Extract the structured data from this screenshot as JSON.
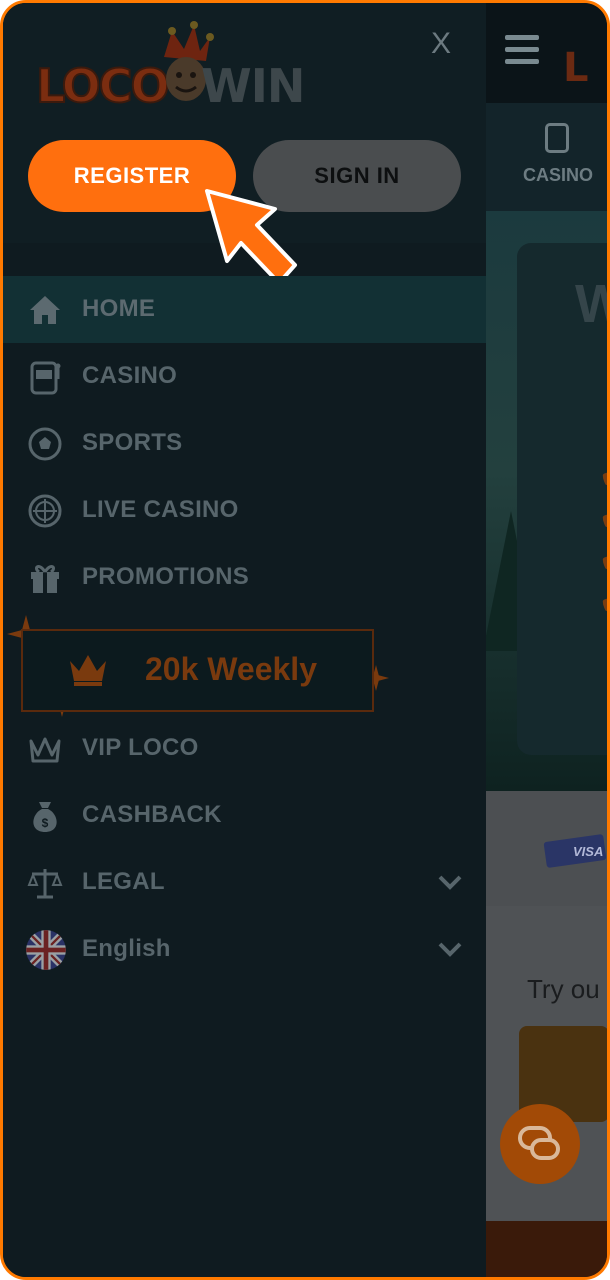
{
  "header": {
    "logo_text_left": "LOCO",
    "logo_text_right": "WIN",
    "close_label": "X"
  },
  "auth": {
    "register_label": "REGISTER",
    "signin_label": "SIGN IN"
  },
  "menu": {
    "items": [
      {
        "label": "HOME",
        "icon": "home-icon",
        "active": true
      },
      {
        "label": "CASINO",
        "icon": "slot-machine-icon"
      },
      {
        "label": "SPORTS",
        "icon": "soccer-ball-icon"
      },
      {
        "label": "LIVE CASINO",
        "icon": "roulette-icon"
      },
      {
        "label": "PROMOTIONS",
        "icon": "gift-icon"
      }
    ],
    "promo_banner": "20k Weekly",
    "items_after": [
      {
        "label": "VIP LOCO",
        "icon": "crown-outline-icon"
      },
      {
        "label": "CASHBACK",
        "icon": "money-bag-icon"
      },
      {
        "label": "LEGAL",
        "icon": "scales-icon",
        "expandable": true
      },
      {
        "label": "English",
        "icon": "uk-flag-icon",
        "expandable": true
      }
    ]
  },
  "background_page": {
    "nav_label": "CASINO",
    "hero_heading_fragment": "W",
    "payment_label": "VISA",
    "try_text": "Try ou"
  },
  "colors": {
    "accent": "#ff6f0e",
    "drawer_bg": "#0f1b20",
    "active_row": "#123034",
    "frame_border": "#ff7a00"
  }
}
